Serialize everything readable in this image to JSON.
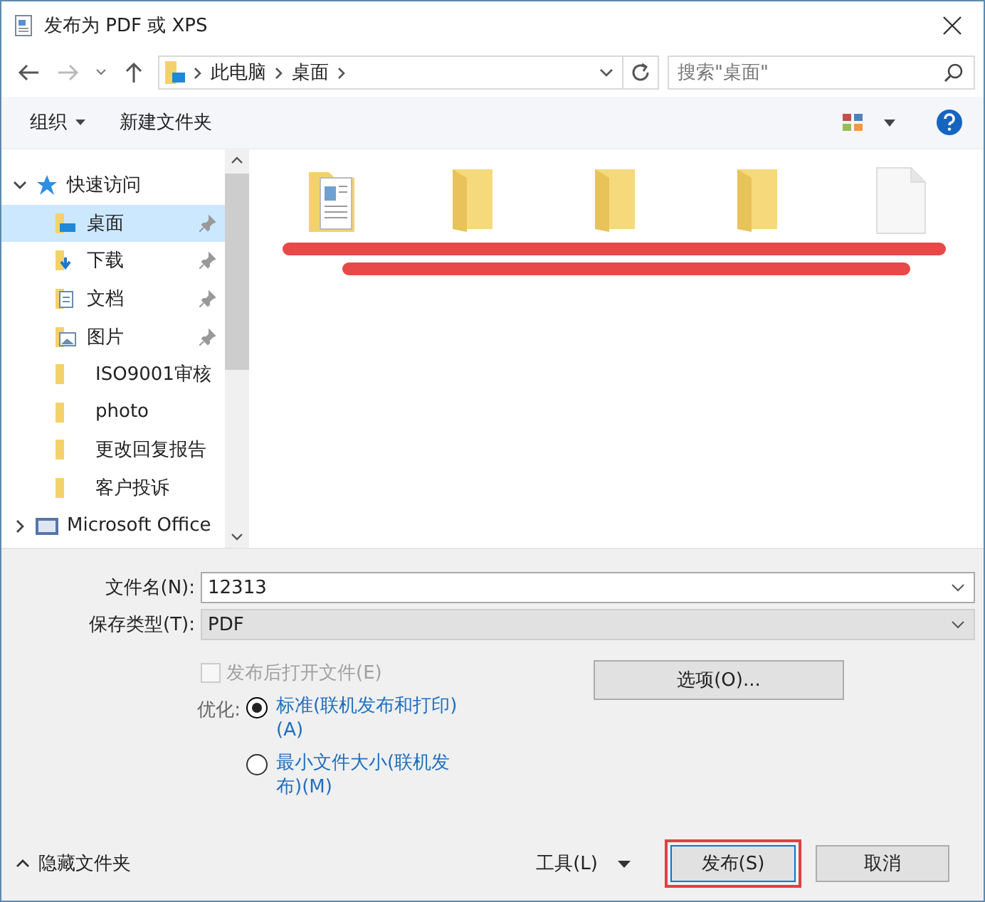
{
  "window": {
    "title": "发布为 PDF 或 XPS"
  },
  "address": {
    "path": [
      "此电脑",
      "桌面"
    ],
    "search_placeholder": "搜索\"桌面\""
  },
  "toolbar": {
    "organize": "组织",
    "new_folder": "新建文件夹"
  },
  "sidebar": {
    "items": [
      {
        "label": "快速访问",
        "kind": "star",
        "expanded": true,
        "children": [
          {
            "label": "桌面",
            "kind": "desktop",
            "pinned": true,
            "selected": true
          },
          {
            "label": "下载",
            "kind": "download",
            "pinned": true,
            "selected": false
          },
          {
            "label": "文档",
            "kind": "documents",
            "pinned": true,
            "selected": false
          },
          {
            "label": "图片",
            "kind": "pictures",
            "pinned": true,
            "selected": false
          },
          {
            "label": "ISO9001审核",
            "kind": "folder",
            "pinned": false,
            "selected": false
          },
          {
            "label": "photo",
            "kind": "folder",
            "pinned": false,
            "selected": false
          },
          {
            "label": "更改回复报告",
            "kind": "folder",
            "pinned": false,
            "selected": false
          },
          {
            "label": "客户投诉",
            "kind": "folder",
            "pinned": false,
            "selected": false
          }
        ]
      },
      {
        "label": "Microsoft Office",
        "kind": "office",
        "expanded": false
      }
    ]
  },
  "files": [
    {
      "kind": "picture-folder"
    },
    {
      "kind": "folder"
    },
    {
      "kind": "folder"
    },
    {
      "kind": "folder"
    },
    {
      "kind": "document"
    }
  ],
  "form": {
    "filename_label": "文件名(N):",
    "filename": "12313",
    "type_label": "保存类型(T):",
    "type": "PDF"
  },
  "options": {
    "open_after": {
      "label": "发布后打开文件(E)",
      "checked": false,
      "disabled": true
    },
    "options_button": "选项(O)...",
    "optimize_label": "优化:",
    "radios": [
      {
        "label": "标准(联机发布和打印)(A)",
        "selected": true
      },
      {
        "label": "最小文件大小(联机发布)(M)",
        "selected": false
      }
    ]
  },
  "footer": {
    "hide_folders": "隐藏文件夹",
    "tools": "工具(L)",
    "publish": "发布(S)",
    "cancel": "取消",
    "publish_highlighted": true
  }
}
